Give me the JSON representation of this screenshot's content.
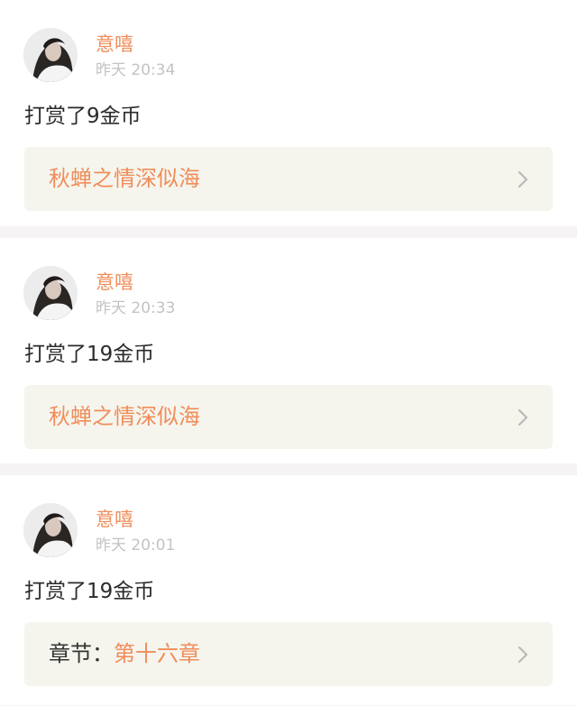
{
  "feed": {
    "items": [
      {
        "user": "意嘻",
        "time": "昨天 20:34",
        "action": "打赏了9金币",
        "link_prefix": "",
        "link_title": "秋蝉之情深似海"
      },
      {
        "user": "意嘻",
        "time": "昨天 20:33",
        "action": "打赏了19金币",
        "link_prefix": "",
        "link_title": "秋蝉之情深似海"
      },
      {
        "user": "意嘻",
        "time": "昨天 20:01",
        "action": "打赏了19金币",
        "link_prefix": "章节：",
        "link_title": "第十六章"
      }
    ]
  },
  "colors": {
    "accent": "#f08d5a",
    "muted": "#c3c3c3",
    "text": "#2b2b2b",
    "link_bg": "#f5f5ee",
    "divider_bg": "#f5f3f3"
  },
  "icons": {
    "avatar": "user-avatar-image",
    "chevron": "chevron-right-icon"
  }
}
